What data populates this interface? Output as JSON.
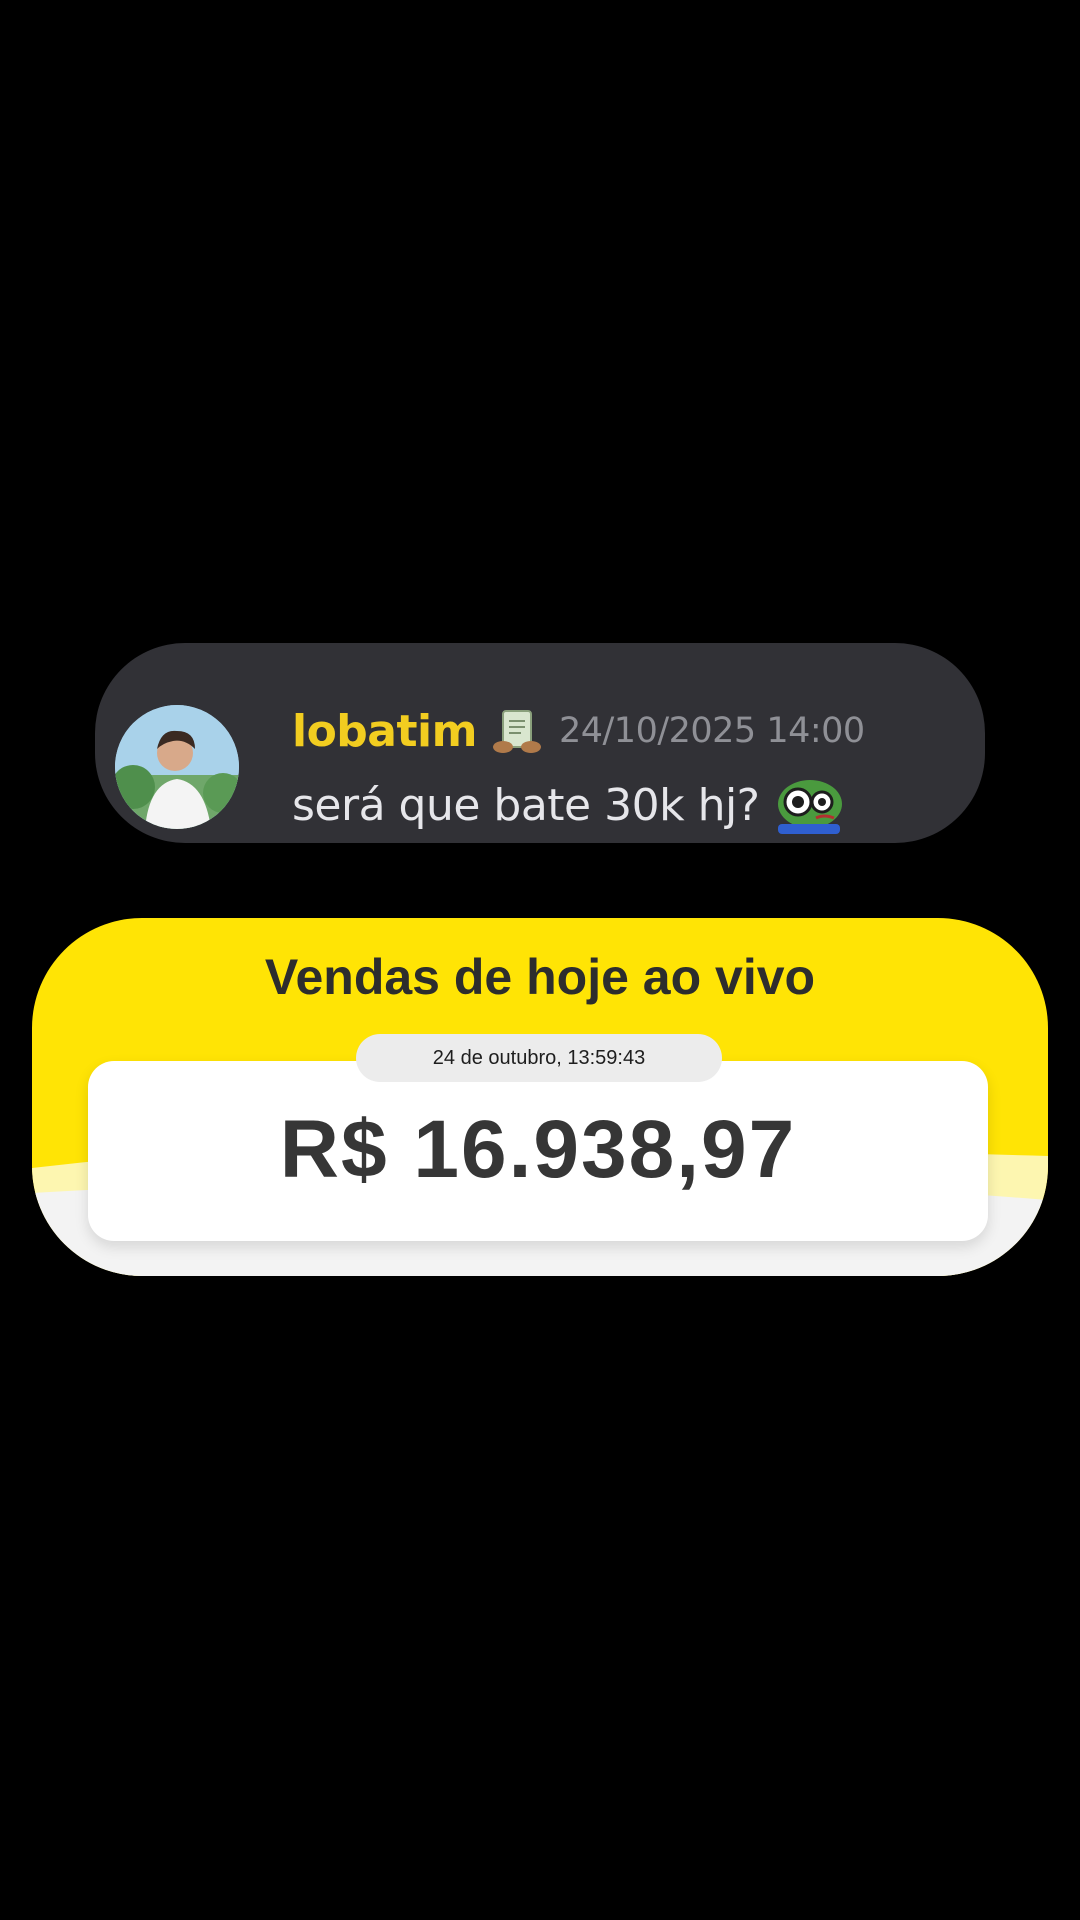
{
  "chat_message": {
    "username": "lobatim",
    "timestamp": "24/10/2025 14:00",
    "text": "será que bate 30k hj?",
    "badge_icon": "money-badge-icon",
    "emoji_icon": "pepe-sad-emoji-icon",
    "username_color": "#f2cd20"
  },
  "sales_panel": {
    "title": "Vendas de hoje ao vivo",
    "date_time": "24 de outubro, 13:59:43",
    "amount": "R$ 16.938,97",
    "accent_color": "#ffe405"
  }
}
